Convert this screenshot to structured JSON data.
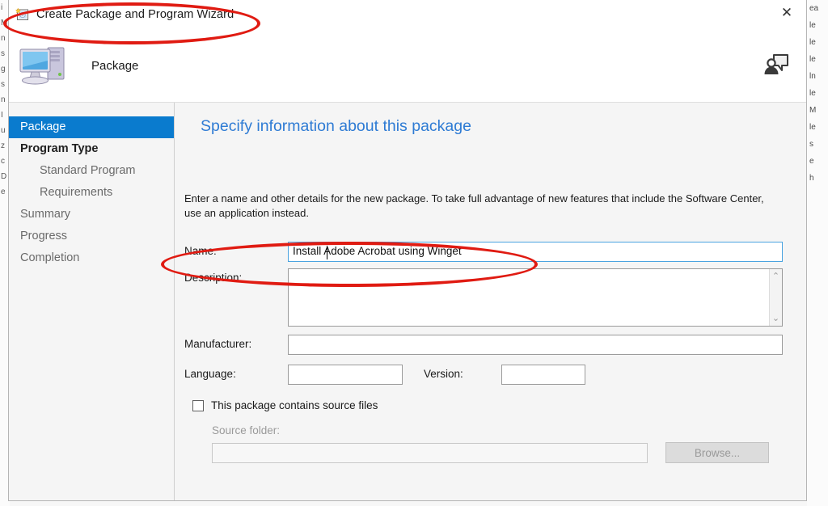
{
  "window": {
    "title": "Create Package and Program Wizard",
    "title_icon": "package-wizard-icon",
    "close_label": "✕"
  },
  "header": {
    "title": "Package",
    "icon": "computer-icon",
    "help_icon": "help-feedback-icon"
  },
  "sidebar": {
    "items": [
      {
        "label": "Package",
        "selected": true,
        "bold": false,
        "sub": false
      },
      {
        "label": "Program Type",
        "selected": false,
        "bold": true,
        "sub": false
      },
      {
        "label": "Standard Program",
        "selected": false,
        "bold": false,
        "sub": true
      },
      {
        "label": "Requirements",
        "selected": false,
        "bold": false,
        "sub": true
      },
      {
        "label": "Summary",
        "selected": false,
        "bold": false,
        "sub": false
      },
      {
        "label": "Progress",
        "selected": false,
        "bold": false,
        "sub": false
      },
      {
        "label": "Completion",
        "selected": false,
        "bold": false,
        "sub": false
      }
    ]
  },
  "content": {
    "heading": "Specify information about this package",
    "intro": "Enter a name and other details for the new package. To take full advantage of new features that include the Software Center, use an application instead."
  },
  "form": {
    "name_label": "Name:",
    "name_value": "Install Adobe Acrobat using Winget",
    "description_label": "Description:",
    "description_value": "",
    "manufacturer_label": "Manufacturer:",
    "manufacturer_value": "",
    "language_label": "Language:",
    "language_value": "",
    "version_label": "Version:",
    "version_value": "",
    "checkbox_label": "This package contains source files",
    "checkbox_checked": false,
    "source_folder_label": "Source folder:",
    "source_folder_value": "",
    "browse_label": "Browse...",
    "scroll_up": "⌃",
    "scroll_down": "⌄"
  },
  "annotations": {
    "color": "#e01b12",
    "shapes": [
      {
        "name": "title-highlight",
        "target": "window-title"
      },
      {
        "name": "name-field-highlight",
        "target": "name-field"
      }
    ]
  },
  "background": {
    "left_fragments": [
      "i",
      "M",
      "n",
      "s",
      "g",
      "s",
      "n",
      "I",
      "u",
      "z",
      "c",
      "D",
      "e"
    ],
    "right_fragments": [
      "ea",
      "le",
      "le",
      "le",
      "ln",
      "le",
      "M",
      "le",
      "s",
      "e",
      "h"
    ]
  }
}
